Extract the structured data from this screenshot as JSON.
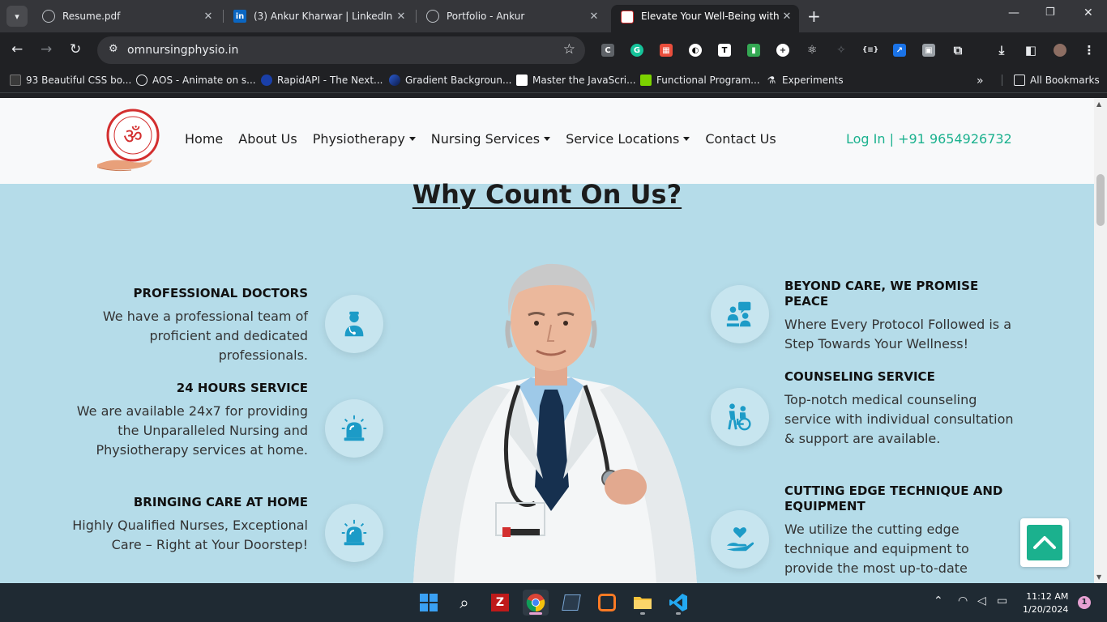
{
  "browser": {
    "tabs": [
      {
        "title": "Resume.pdf",
        "active": false
      },
      {
        "title": "(3) Ankur Kharwar | LinkedIn",
        "active": false
      },
      {
        "title": "Portfolio - Ankur",
        "active": false
      },
      {
        "title": "Elevate Your Well-Being with Om",
        "active": true
      }
    ],
    "url": "omnursingphysio.in",
    "bookmarks": [
      "93 Beautiful CSS bo...",
      "AOS - Animate on s...",
      "RapidAPI - The Next...",
      "Gradient Backgroun...",
      "Master the JavaScri...",
      "Functional Program...",
      "Experiments"
    ],
    "all_bookmarks_label": "All Bookmarks"
  },
  "site": {
    "nav": {
      "links": [
        "Home",
        "About Us",
        "Physiotherapy",
        "Nursing Services",
        "Service Locations",
        "Contact Us"
      ],
      "login": "Log In | +91 9654926732"
    },
    "section_title": "Why Count On Us?",
    "features_left": [
      {
        "title": "PROFESSIONAL DOCTORS",
        "text": "We have a professional team of proficient and dedicated professionals.",
        "icon": "doctor-icon"
      },
      {
        "title": "24 HOURS SERVICE",
        "text": "We are available 24x7 for providing the Unparalleled Nursing and Physiotherapy services at home.",
        "icon": "siren-icon"
      },
      {
        "title": "BRINGING CARE AT HOME",
        "text": "Highly Qualified Nurses, Exceptional Care – Right at Your Doorstep!",
        "icon": "siren-icon"
      }
    ],
    "features_right": [
      {
        "title": "BEYOND CARE, WE PROMISE PEACE",
        "text": "Where Every Protocol Followed is a Step Towards Your Wellness!",
        "icon": "consultation-icon"
      },
      {
        "title": "COUNSELING SERVICE",
        "text": "Top-notch medical counseling service with individual consultation & support are available.",
        "icon": "wheelchair-icon"
      },
      {
        "title": "CUTTING EDGE TECHNIQUE AND EQUIPMENT",
        "text": "We utilize the cutting edge technique and equipment to provide the most up-to-date",
        "icon": "hand-heart-icon"
      }
    ],
    "accent_color": "#1bb18e",
    "section_bg": "#b5dce9"
  },
  "taskbar": {
    "time": "11:12 AM",
    "date": "1/20/2024",
    "notifications": "1"
  }
}
